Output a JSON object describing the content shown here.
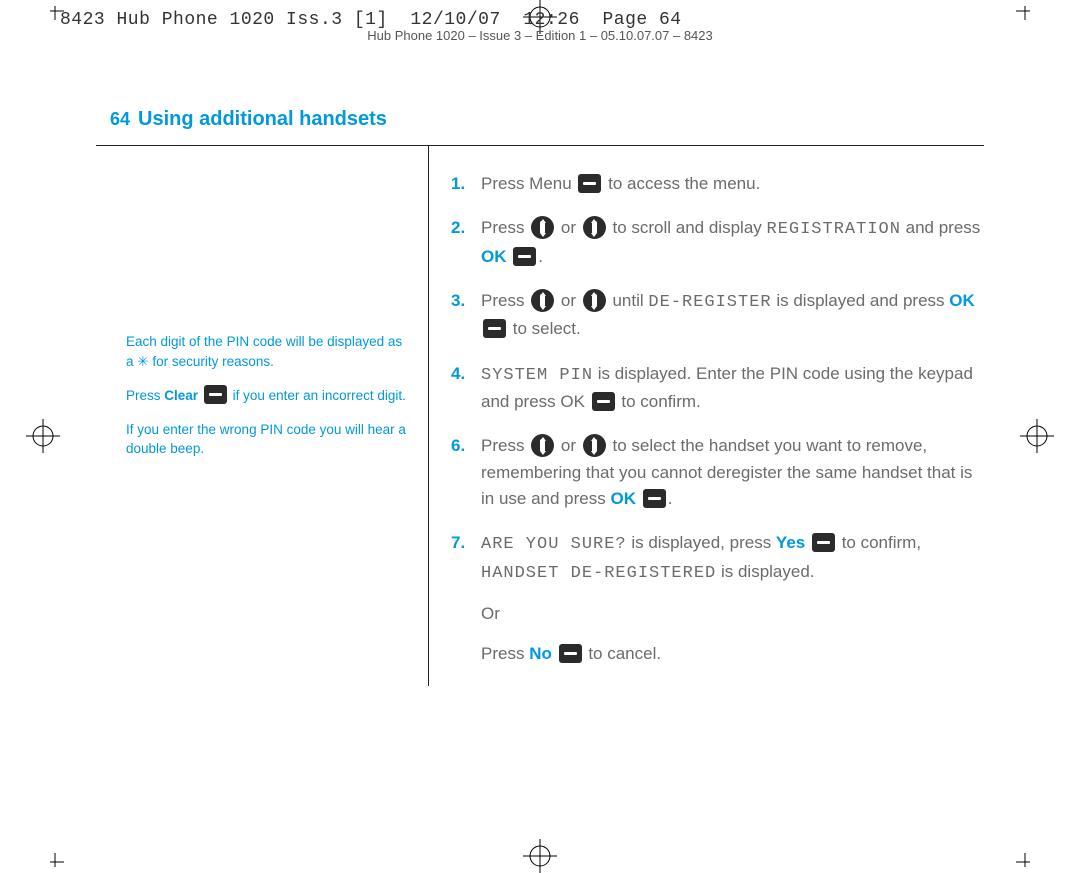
{
  "slug1": "8423 Hub Phone 1020 Iss.3 [1]  12/10/07  12:26  Page 64",
  "slug2": "Hub Phone 1020 – Issue 3 – Edition 1 – 05.10.07.07 – 8423",
  "page_number": "64",
  "title": "Using additional handsets",
  "side": {
    "p1": "Each digit of the PIN code will be displayed as a ✳ for security reasons.",
    "p2a": "Press ",
    "p2b": "Clear",
    "p2c": " if you enter an incorrect digit.",
    "p3": "If you enter the wrong PIN code you will hear a double beep."
  },
  "steps": {
    "s1": {
      "num": "1.",
      "a": "Press Menu ",
      "b": " to access the menu."
    },
    "s2": {
      "num": "2.",
      "a": "Press ",
      "b": " or ",
      "c": " to scroll and display ",
      "lcd": "REGISTRATION",
      "d": " and press ",
      "ok": "OK",
      "e": "."
    },
    "s3": {
      "num": "3.",
      "a": "Press ",
      "b": " or ",
      "c": " until ",
      "lcd": "DE-REGISTER",
      "d": " is displayed and press ",
      "ok": "OK",
      "e": " to select."
    },
    "s4": {
      "num": "4.",
      "lcd": "SYSTEM PIN",
      "a": " is displayed. Enter the PIN code using the keypad and press OK ",
      "b": " to confirm."
    },
    "s6": {
      "num": "6.",
      "a": "Press ",
      "b": " or ",
      "c": " to select the handset you want to remove, remembering that you cannot deregister the same handset that is in use and press ",
      "ok": "OK",
      "d": "."
    },
    "s7": {
      "num": "7.",
      "lcd1": "ARE YOU SURE?",
      "a": " is displayed, press ",
      "yes": "Yes",
      "b": " to confirm, ",
      "lcd2": "HANDSET DE-REGISTERED",
      "c": " is displayed.",
      "or": "Or",
      "d": "Press ",
      "no": "No",
      "e": " to cancel."
    }
  }
}
